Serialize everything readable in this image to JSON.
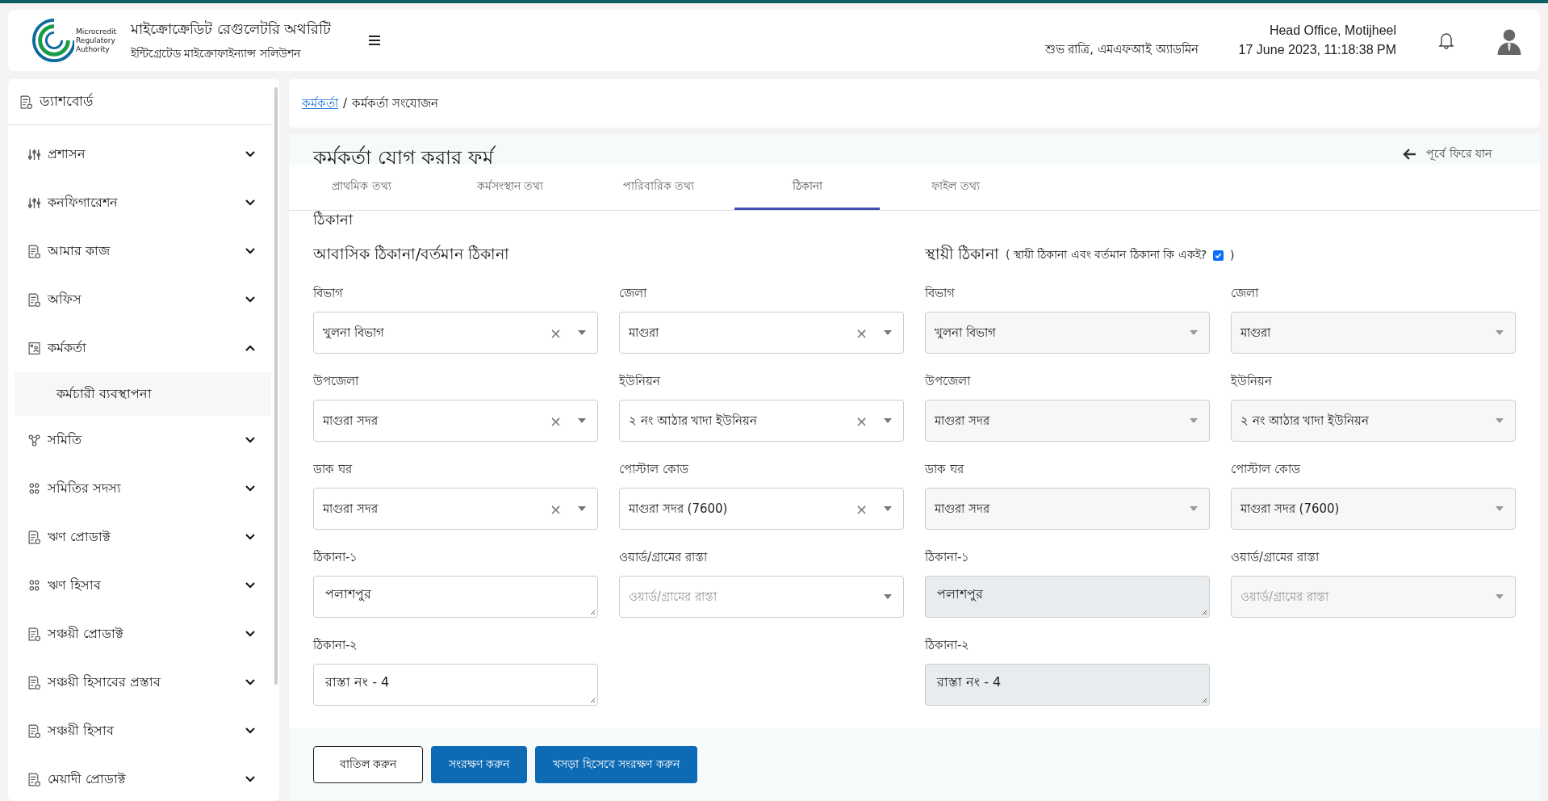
{
  "header": {
    "logo_text": [
      "Microcredit",
      "Regulatory",
      "Authority"
    ],
    "title": "মাইক্রোক্রেডিট রেগুলেটরি অথরিটি",
    "subtitle": "ইন্টিগ্রেটেড মাইক্রোফাইন্যান্স সলিউশন",
    "greeting": "শুভ রাত্রি, এমএফআই অ্যাডমিন",
    "office": "Head Office, Motijheel",
    "datetime": "17 June 2023, 11:18:38 PM"
  },
  "sidebar": {
    "items": [
      {
        "label": "ড্যাশবোর্ড",
        "kind": "single"
      },
      {
        "label": "প্রশাসন",
        "kind": "group",
        "expanded": false
      },
      {
        "label": "কনফিগারেশন",
        "kind": "group",
        "expanded": false
      },
      {
        "label": "আমার কাজ",
        "kind": "group",
        "expanded": false
      },
      {
        "label": "অফিস",
        "kind": "group",
        "expanded": false
      },
      {
        "label": "কর্মকর্তা",
        "kind": "group",
        "expanded": true,
        "children": [
          {
            "label": "কর্মচারী ব্যবস্থাপনা"
          }
        ]
      },
      {
        "label": "সমিতি",
        "kind": "group",
        "expanded": false
      },
      {
        "label": "সমিতির সদস্য",
        "kind": "group",
        "expanded": false
      },
      {
        "label": "ঋণ প্রোডাক্ট",
        "kind": "group",
        "expanded": false
      },
      {
        "label": "ঋণ হিসাব",
        "kind": "group",
        "expanded": false
      },
      {
        "label": "সঞ্চয়ী প্রোডাক্ট",
        "kind": "group",
        "expanded": false
      },
      {
        "label": "সঞ্চয়ী হিসাবের প্রস্তাব",
        "kind": "group",
        "expanded": false
      },
      {
        "label": "সঞ্চয়ী হিসাব",
        "kind": "group",
        "expanded": false
      },
      {
        "label": "মেয়াদী প্রোডাক্ট",
        "kind": "group",
        "expanded": false
      }
    ]
  },
  "breadcrumb": {
    "link": "কর্মকর্তা",
    "separator": "/",
    "current": "কর্মকর্তা সংযোজন"
  },
  "form": {
    "title": "কর্মকর্তা যোগ করার ফর্ম",
    "back": "পূর্বে ফিরে যান",
    "tabs": [
      {
        "label": "প্রাথমিক তথ্য",
        "selected": false
      },
      {
        "label": "কর্মসংস্থান তথ্য",
        "selected": false
      },
      {
        "label": "পারিবারিক তথ্য",
        "selected": false
      },
      {
        "label": "ঠিকানা",
        "selected": true
      },
      {
        "label": "ফাইল তথ্য",
        "selected": false
      }
    ],
    "section_title": "ঠিকানা",
    "present": {
      "heading": "আবাসিক ঠিকানা/বর্তমান ঠিকানা",
      "fields": [
        {
          "label": "বিভাগ",
          "kind": "select",
          "value": "খুলনা বিভাগ",
          "clear": "×",
          "disabled": false
        },
        {
          "label": "জেলা",
          "kind": "select",
          "value": "মাগুরা",
          "clear": "×",
          "disabled": false
        },
        {
          "label": "উপজেলা",
          "kind": "select",
          "value": "মাগুরা সদর",
          "clear": "×",
          "disabled": false
        },
        {
          "label": "ইউনিয়ন",
          "kind": "select",
          "value": "২ নং আঠার খাদা ইউনিয়ন",
          "clear": "×",
          "disabled": false
        },
        {
          "label": "ডাক ঘর",
          "kind": "select",
          "value": "মাগুরা সদর",
          "clear": "×",
          "disabled": false
        },
        {
          "label": "পোস্টাল কোড",
          "kind": "select",
          "value": "মাগুরা সদর (7600)",
          "clear": "×",
          "disabled": false
        },
        {
          "label": "ঠিকানা-১",
          "kind": "textarea",
          "value": "পলাশপুর",
          "disabled": false
        },
        {
          "label": "ওয়ার্ড/গ্রামের রাস্তা",
          "kind": "select",
          "placeholder": "ওয়ার্ড/গ্রামের রাস্তা",
          "disabled": false
        },
        {
          "label": "ঠিকানা-২",
          "kind": "textarea",
          "value": "রাস্তা নং - 4",
          "disabled": false
        }
      ]
    },
    "permanent": {
      "heading": "স্থায়ী ঠিকানা",
      "same_open": "( স্থায়ী ঠিকানা এবং বর্তমান ঠিকানা কি একই?",
      "same_checked": true,
      "same_close": ")",
      "fields": [
        {
          "label": "বিভাগ",
          "kind": "select",
          "value": "খুলনা বিভাগ",
          "disabled": true
        },
        {
          "label": "জেলা",
          "kind": "select",
          "value": "মাগুরা",
          "disabled": true
        },
        {
          "label": "উপজেলা",
          "kind": "select",
          "value": "মাগুরা সদর",
          "disabled": true
        },
        {
          "label": "ইউনিয়ন",
          "kind": "select",
          "value": "২ নং আঠার খাদা ইউনিয়ন",
          "disabled": true
        },
        {
          "label": "ডাক ঘর",
          "kind": "select",
          "value": "মাগুরা সদর",
          "disabled": true
        },
        {
          "label": "পোস্টাল কোড",
          "kind": "select",
          "value": "মাগুরা সদর (7600)",
          "disabled": true
        },
        {
          "label": "ঠিকানা-১",
          "kind": "textarea",
          "value": "পলাশপুর",
          "disabled": true
        },
        {
          "label": "ওয়ার্ড/গ্রামের রাস্তা",
          "kind": "select",
          "placeholder": "ওয়ার্ড/গ্রামের রাস্তা",
          "disabled": true
        },
        {
          "label": "ঠিকানা-২",
          "kind": "textarea",
          "value": "রাস্তা নং - 4",
          "disabled": true
        }
      ]
    },
    "buttons": [
      {
        "label": "বাতিল করুন",
        "kind": "outline"
      },
      {
        "label": "সংরক্ষণ করুন",
        "kind": "primary"
      },
      {
        "label": "খসড়া হিসেবে সংরক্ষণ করুন",
        "kind": "primary"
      }
    ]
  }
}
